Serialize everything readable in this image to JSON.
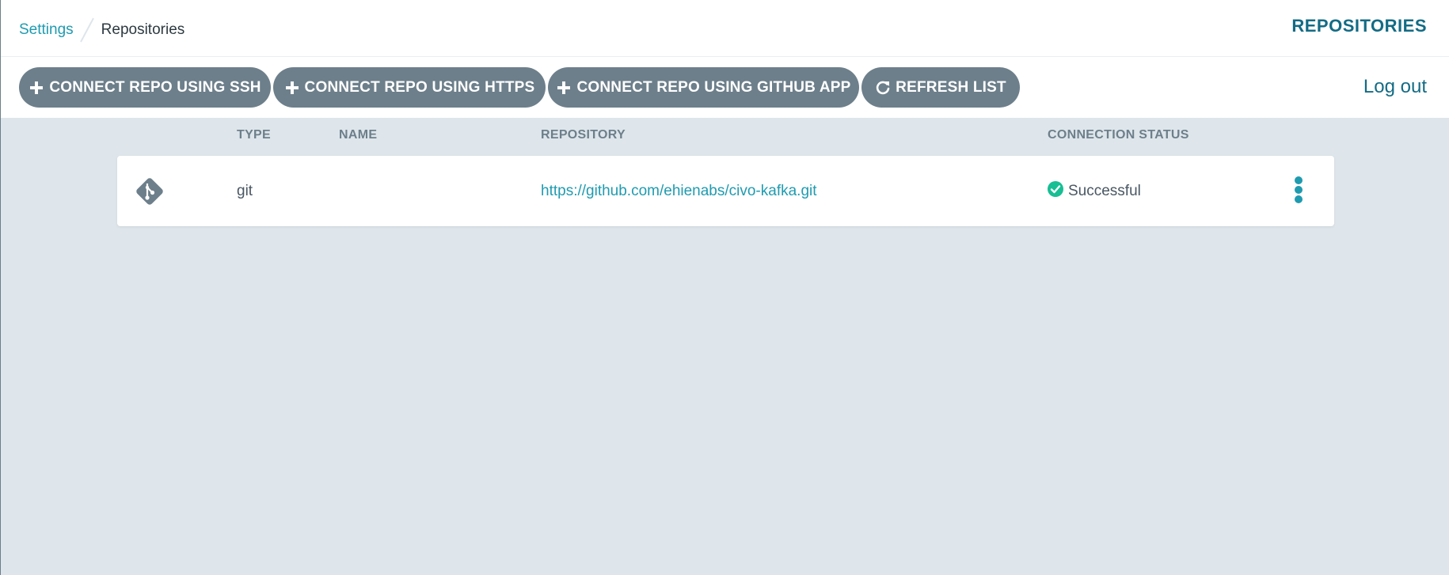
{
  "breadcrumb": {
    "parent": "Settings",
    "current": "Repositories"
  },
  "header": {
    "title": "REPOSITORIES"
  },
  "toolbar": {
    "connect_ssh": "CONNECT REPO USING SSH",
    "connect_https": "CONNECT REPO USING HTTPS",
    "connect_github_app": "CONNECT REPO USING GITHUB APP",
    "refresh": "REFRESH LIST",
    "logout": "Log out"
  },
  "table": {
    "columns": [
      "TYPE",
      "NAME",
      "REPOSITORY",
      "CONNECTION STATUS"
    ],
    "rows": [
      {
        "icon": "git-icon",
        "type": "git",
        "name": "",
        "repository": "https://github.com/ehienabs/civo-kafka.git",
        "status": "Successful",
        "status_icon": "check-circle-icon"
      }
    ]
  },
  "colors": {
    "accent": "#1f9bb0",
    "title": "#136b85",
    "button_bg": "#6d7f8b",
    "content_bg": "#dee6eb",
    "success": "#18be94"
  }
}
